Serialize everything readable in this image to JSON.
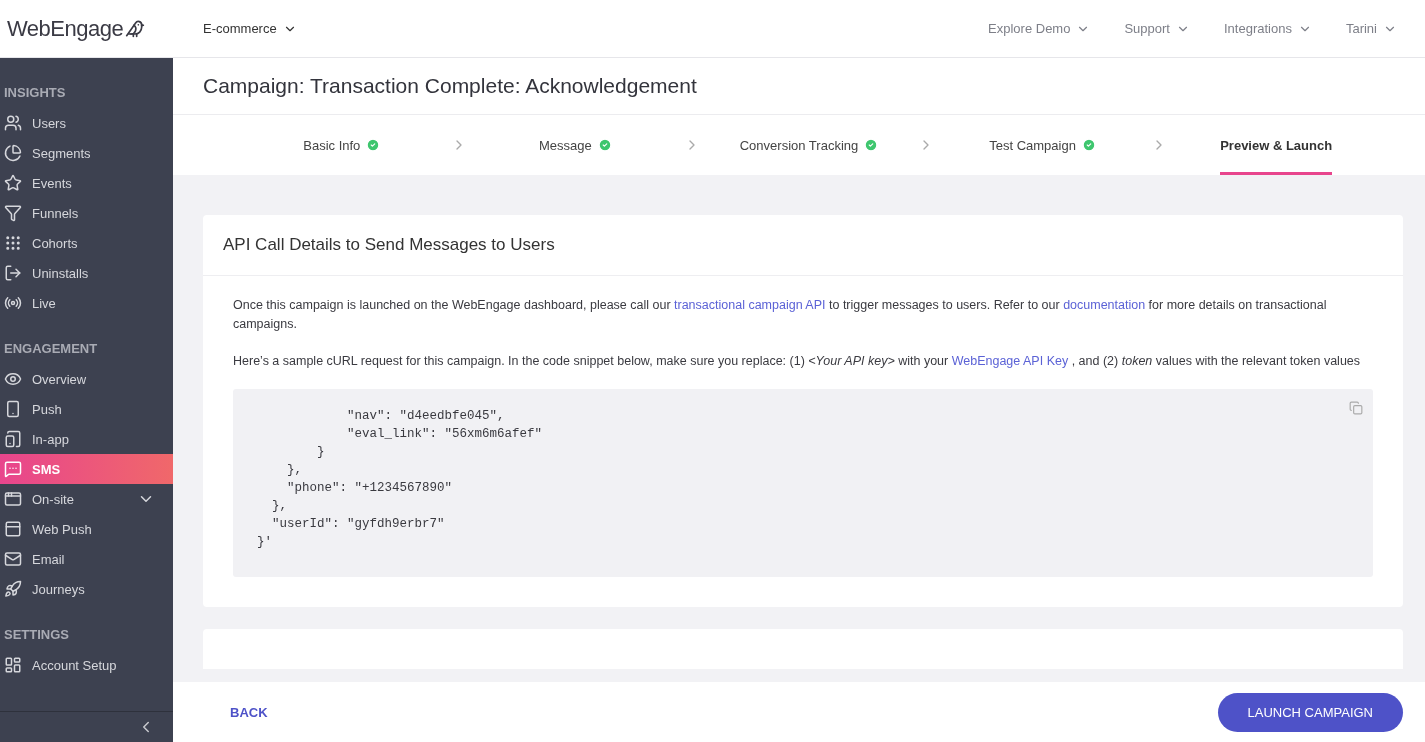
{
  "header": {
    "logo": "WebEngage",
    "project": "E-commerce",
    "menus": [
      {
        "label": "Explore Demo"
      },
      {
        "label": "Support"
      },
      {
        "label": "Integrations"
      },
      {
        "label": "Tarini"
      }
    ]
  },
  "sidebar": {
    "sections": [
      {
        "title": "INSIGHTS",
        "items": [
          {
            "label": "Users",
            "selected": false,
            "kind": "link"
          },
          {
            "label": "Segments",
            "selected": false,
            "kind": "link"
          },
          {
            "label": "Events",
            "selected": false,
            "kind": "link"
          },
          {
            "label": "Funnels",
            "selected": false,
            "kind": "link"
          },
          {
            "label": "Cohorts",
            "selected": false,
            "kind": "link"
          },
          {
            "label": "Uninstalls",
            "selected": false,
            "kind": "link"
          },
          {
            "label": "Live",
            "selected": false,
            "kind": "link"
          }
        ]
      },
      {
        "title": "ENGAGEMENT",
        "items": [
          {
            "label": "Overview",
            "selected": false,
            "kind": "link"
          },
          {
            "label": "Push",
            "selected": false,
            "kind": "link"
          },
          {
            "label": "In-app",
            "selected": false,
            "kind": "link"
          },
          {
            "label": "SMS",
            "selected": true,
            "kind": "link"
          },
          {
            "label": "On-site",
            "selected": false,
            "kind": "group"
          },
          {
            "label": "Web Push",
            "selected": false,
            "kind": "link"
          },
          {
            "label": "Email",
            "selected": false,
            "kind": "link"
          },
          {
            "label": "Journeys",
            "selected": false,
            "kind": "link"
          }
        ]
      },
      {
        "title": "SETTINGS",
        "items": [
          {
            "label": "Account Setup",
            "selected": false,
            "kind": "link"
          }
        ]
      }
    ]
  },
  "page_title": "Campaign: Transaction Complete: Acknowledgement",
  "steps": [
    {
      "label": "Basic Info",
      "done": true,
      "selected": false
    },
    {
      "label": "Message",
      "done": true,
      "selected": false
    },
    {
      "label": "Conversion Tracking",
      "done": true,
      "selected": false
    },
    {
      "label": "Test Campaign",
      "done": true,
      "selected": false
    },
    {
      "label": "Preview & Launch",
      "done": false,
      "selected": true
    }
  ],
  "card": {
    "title": "API Call Details to Send Messages to Users",
    "paragraphs": [
      [
        {
          "kind": "text",
          "text": "Once this campaign is launched on the WebEngage dashboard, please call our "
        },
        {
          "kind": "link",
          "text": "transactional campaign API"
        },
        {
          "kind": "text",
          "text": " to trigger messages to users. Refer to our "
        },
        {
          "kind": "link",
          "text": "documentation"
        },
        {
          "kind": "text",
          "text": " for more details on transactional campaigns."
        }
      ],
      [
        {
          "kind": "text",
          "text": "Here’s a sample cURL request for this campaign. In the code snippet below, make sure you replace: (1) *<Your API key>* with your "
        },
        {
          "kind": "link",
          "text": "WebEngage API Key"
        },
        {
          "kind": "text",
          "text": " , and (2) *token* values with the relevant token values"
        }
      ]
    ],
    "code_lines": [
      "            \"nav\": \"d4eedbfe045\",",
      "            \"eval_link\": \"56xm6m6afef\"",
      "        }",
      "    },",
      "    \"phone\": \"+1234567890\"",
      "  },",
      "  \"userId\": \"gyfdh9erbr7\"",
      "}'"
    ]
  },
  "footer": {
    "back": "BACK",
    "launch": "LAUNCH CAMPAIGN"
  }
}
